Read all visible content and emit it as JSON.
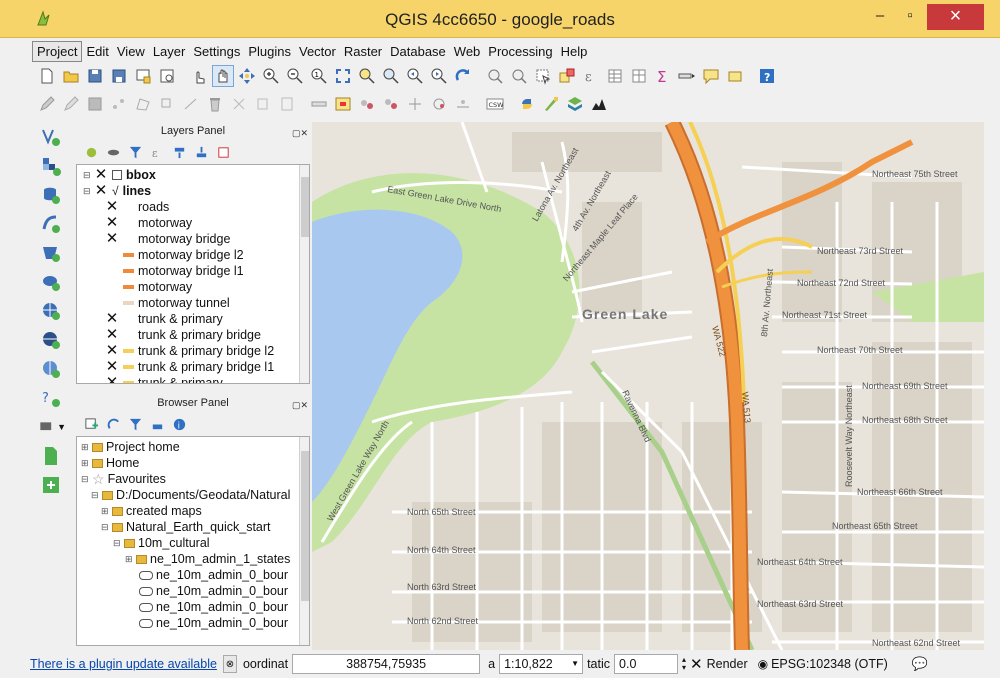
{
  "window": {
    "title": "QGIS 4cc6650 - google_roads",
    "min": "–",
    "max": "▫",
    "close": "×"
  },
  "menu": [
    "Project",
    "Edit",
    "View",
    "Layer",
    "Settings",
    "Plugins",
    "Vector",
    "Raster",
    "Database",
    "Web",
    "Processing",
    "Help"
  ],
  "layers_panel": {
    "title": "Layers Panel",
    "controls": "▢✕",
    "items": [
      {
        "label": "bbox",
        "bold": true,
        "level": 0,
        "swatch": ""
      },
      {
        "label": "lines",
        "bold": true,
        "level": 0,
        "swatch": ""
      },
      {
        "label": "roads",
        "level": 1,
        "swatch": ""
      },
      {
        "label": "motorway",
        "level": 1,
        "swatch": ""
      },
      {
        "label": "motorway bridge",
        "level": 1,
        "swatch": ""
      },
      {
        "label": "motorway bridge l2",
        "level": 1,
        "swatch": "#ee8a3a"
      },
      {
        "label": "motorway bridge l1",
        "level": 1,
        "swatch": "#ee8a3a"
      },
      {
        "label": "motorway",
        "level": 1,
        "swatch": "#ee8a3a"
      },
      {
        "label": "motorway tunnel",
        "level": 1,
        "swatch": "#e9d7c2"
      },
      {
        "label": "trunk & primary",
        "level": 1,
        "swatch": ""
      },
      {
        "label": "trunk & primary bridge",
        "level": 1,
        "swatch": ""
      },
      {
        "label": "trunk & primary bridge l2",
        "level": 1,
        "swatch": "#f4cf5a"
      },
      {
        "label": "trunk & primary bridge l1",
        "level": 1,
        "swatch": "#f4cf5a"
      },
      {
        "label": "trunk & primary",
        "level": 1,
        "swatch": "#f4cf5a"
      }
    ]
  },
  "browser_panel": {
    "title": "Browser Panel",
    "controls": "▢✕",
    "items": [
      {
        "label": "Project home",
        "type": "folder",
        "indent": 0
      },
      {
        "label": "Home",
        "type": "folder",
        "indent": 0
      },
      {
        "label": "Favourites",
        "type": "star",
        "indent": 0
      },
      {
        "label": "D:/Documents/Geodata/Natural",
        "type": "folder",
        "indent": 1
      },
      {
        "label": "created maps",
        "type": "folder",
        "indent": 2
      },
      {
        "label": "Natural_Earth_quick_start",
        "type": "folder",
        "indent": 2
      },
      {
        "label": "10m_cultural",
        "type": "folder",
        "indent": 3
      },
      {
        "label": "ne_10m_admin_1_states",
        "type": "folder",
        "indent": 4
      },
      {
        "label": "ne_10m_admin_0_bour",
        "type": "leaf",
        "indent": 5
      },
      {
        "label": "ne_10m_admin_0_bour",
        "type": "leaf",
        "indent": 5
      },
      {
        "label": "ne_10m_admin_0_bour",
        "type": "leaf",
        "indent": 5
      },
      {
        "label": "ne_10m_admin_0_bour",
        "type": "leaf",
        "indent": 5
      }
    ]
  },
  "map": {
    "colors": {
      "water": "#a8c8f0",
      "park": "#c6e3a4",
      "land": "#e8e4dc",
      "motorway": "#f0913e",
      "trunk": "#f6cf55",
      "street": "#ffffff",
      "building": "#d8d2c8"
    },
    "labels": [
      "Green Lake",
      "Northeast 75th Street",
      "Northeast 73rd Street",
      "Northeast 72nd Street",
      "Northeast 71st Street",
      "Northeast 70th Street",
      "Northeast 69th Street",
      "Northeast 68th Street",
      "Northeast 66th Street",
      "Northeast 65th Street",
      "Northeast 64th Street",
      "Northeast 63rd Street",
      "Northeast 62nd Street",
      "East Green Lake Drive North",
      "North 65th Street",
      "North 64th Street",
      "North 63rd Street",
      "North 62nd Street",
      "West Green Lake Way North",
      "WA 522",
      "WA 513",
      "Latona Av. Northeast",
      "4th Av. Northeast",
      "Northeast Maple Leaf Place",
      "8th Av. Northeast",
      "Roosevelt Way Northeast",
      "Ravenna Blvd"
    ]
  },
  "status": {
    "plugin_update": "There is a plugin update available",
    "coord_label": "oordinat",
    "coordinate": "388754,75935",
    "scale_label": "a",
    "scale": "1:10,822",
    "rotation_label": "tatic",
    "rotation": "0.0",
    "render_label": "Render",
    "crs": "EPSG:102348 (OTF)"
  }
}
